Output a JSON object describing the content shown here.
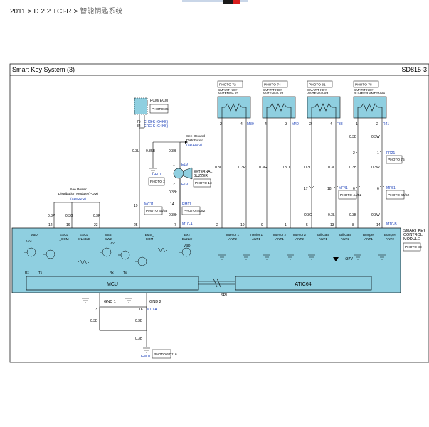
{
  "breadcrumb": [
    "2011",
    "D 2.2 TCI-R",
    "智能钥匙系统"
  ],
  "breadcrumb_sep": ">",
  "diagram": {
    "title": "Smart Key System (3)",
    "code": "SD815-3",
    "colors": {
      "module_fill": "#8fcfe0",
      "wire_label": "#1a3fb8",
      "wire": "#000000"
    },
    "pcm": {
      "title": "PCM/ ECM",
      "photo": "PHOTO 35",
      "pins": [
        "75",
        "82"
      ],
      "connectors": [
        "CHG-K (G4KE)",
        "CRG-K (G4KB)"
      ]
    },
    "ground_distribution": {
      "text": "See Ground Distribution",
      "ref": "(SD130-3)"
    },
    "power_distribution": {
      "text": "See Power Distribution Module (PDM)",
      "ref": "(SD822-2)"
    },
    "ge01": {
      "label": "GE01",
      "photo": "PHOTO 2"
    },
    "external_buzzer": {
      "title": "EXTERNAL BUZZER",
      "photo": "PHOTO 13",
      "connector": "E19",
      "pins": [
        "1",
        "2"
      ]
    },
    "antennas": [
      {
        "photo": "PHOTO 72",
        "title": "SMART KEY ANTENNA #1",
        "pins": [
          "2",
          "4"
        ],
        "conn": "M39"
      },
      {
        "photo": "PHOTO 74",
        "title": "SMART KEY ANTENNA #2",
        "pins": [
          "4",
          "3"
        ],
        "conn": "M40"
      },
      {
        "photo": "PHOTO 81",
        "title": "SMART KEY ANTENNA #3",
        "pins": [
          "2",
          "4"
        ],
        "conn": "F38"
      },
      {
        "photo": "PHOTO 78",
        "title": "SMART KEY BUMPER ANTENNA",
        "pins": [
          "1",
          "2"
        ],
        "conn": "R41"
      }
    ],
    "fr21": {
      "conn": "FR21",
      "photo": "PHOTO 75",
      "pins": [
        "2",
        "1"
      ]
    },
    "mf41": {
      "conn": "MF41",
      "photo": "PHOTO 44/52",
      "pins": [
        "17",
        "18"
      ]
    },
    "mf51": {
      "conn": "MF51",
      "photo": "PHOTO 44/52",
      "pins": [
        "6",
        "6"
      ]
    },
    "mc11": {
      "conn": "MC11",
      "photo": "PHOTO 45/68"
    },
    "em11": {
      "conn": "EM11",
      "photo": "PHOTO 44/82",
      "pin": "14"
    },
    "module": {
      "title": "SMART KEY CONTROL MODULE",
      "photo": "PHOTO 88",
      "conn_top": "M10-B",
      "conn_a": "M10-A"
    },
    "wire_colors": {
      "w03p": "0.3P",
      "w03g": "0.3G",
      "w03l": "0.3L",
      "w085b": "0.85B",
      "w03b": "0.3B",
      "w03br": "0.3Br",
      "w03r": "0.3R",
      "w03o": "0.3O",
      "w03w": "0.3W"
    },
    "module_pins": [
      "12",
      "16",
      "23",
      "25",
      "7",
      "2",
      "10",
      "9",
      "1",
      "5",
      "13",
      "8",
      "14"
    ],
    "terminals": {
      "vbd_escl": "VBD",
      "escl_com": "ESCL _COM",
      "escl_enable": "ESCL ENABLE",
      "ssb_sw2": "SSB SW2",
      "ems_com": "EMS_ COM",
      "ext_buzzer": "EXT Buzzer",
      "int1_ant2": "Interior 1 ANT2",
      "int1_ant1": "Interior 1 ANT1",
      "int2_ant1": "Interior 2 ANT1",
      "int2_ant2": "Interior 2 ANT2",
      "tg_ant1": "Tail Gate ANT1",
      "tg_ant2": "Tail Gate ANT2",
      "bumper_ant1": "Bumper ANT1",
      "bumper_ant2": "Bumper ANT2"
    },
    "small_labels": {
      "vcc": "Vcc",
      "vbd": "VBD",
      "rx": "Rx",
      "tx": "Tx",
      "v37": "+37V"
    },
    "mcu": "MCU",
    "atic": "ATIC64",
    "spi": "SPI",
    "gnd": {
      "gnd1": "GND 1",
      "gnd2": "GND 2",
      "pin3": "3",
      "pin16": "16",
      "conn": "M10-A",
      "wire": "0.3B"
    },
    "gm01": {
      "label": "GM01",
      "photo": "PHOTO 67/116"
    }
  }
}
